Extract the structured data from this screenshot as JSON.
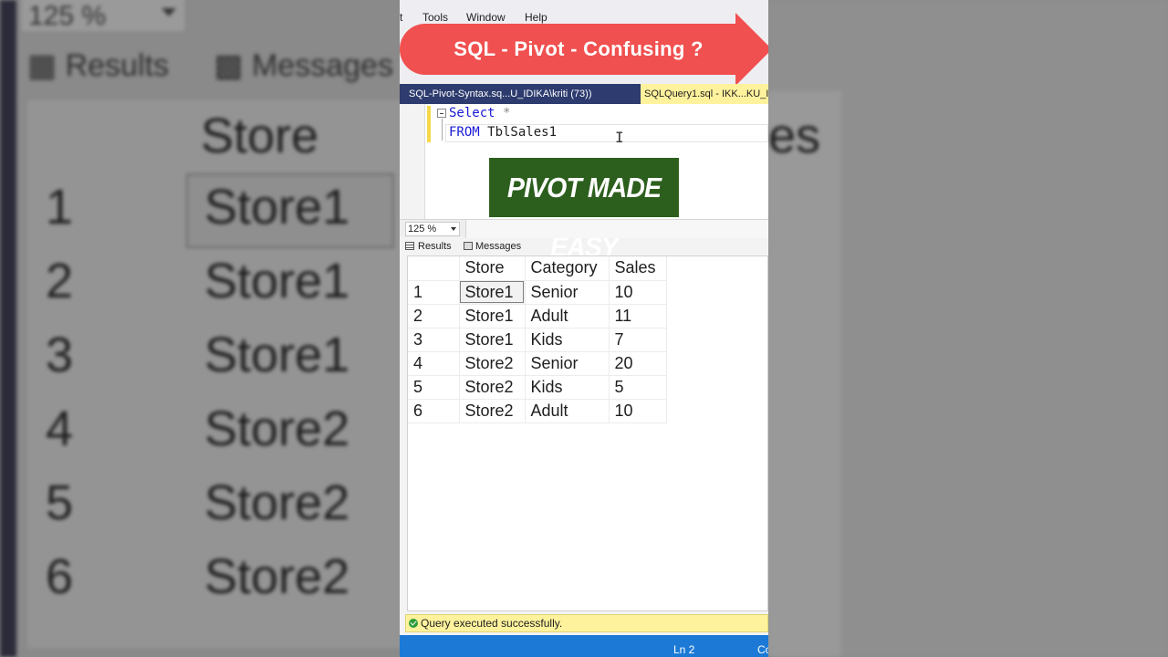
{
  "menu": {
    "items": [
      "t",
      "Tools",
      "Window",
      "Help"
    ]
  },
  "banner": {
    "text": "SQL - Pivot - Confusing ?",
    "color": "#f0504f"
  },
  "doc_tabs": {
    "inactive": "SQL-Pivot-Syntax.sq...U_IDIKA\\kriti (73))",
    "active": "SQLQuery1.sql - IKK...KU_I"
  },
  "editor": {
    "line1_keyword": "Select",
    "line1_rest": " *",
    "line2_keyword": "FROM",
    "line2_rest": " TblSales1"
  },
  "overlay_badge": {
    "text": "PIVOT MADE EASY",
    "color": "#2c5f1d"
  },
  "zoom": {
    "value": "125 %"
  },
  "result_tabs": {
    "results": "Results",
    "messages": "Messages"
  },
  "results_table": {
    "columns": [
      "Store",
      "Category",
      "Sales"
    ],
    "rows": [
      {
        "n": "1",
        "store": "Store1",
        "category": "Senior",
        "sales": "10"
      },
      {
        "n": "2",
        "store": "Store1",
        "category": "Adult",
        "sales": "11"
      },
      {
        "n": "3",
        "store": "Store1",
        "category": "Kids",
        "sales": "7"
      },
      {
        "n": "4",
        "store": "Store2",
        "category": "Senior",
        "sales": "20"
      },
      {
        "n": "5",
        "store": "Store2",
        "category": "Kids",
        "sales": "5"
      },
      {
        "n": "6",
        "store": "Store2",
        "category": "Adult",
        "sales": "10"
      }
    ]
  },
  "status": {
    "message": "Query executed successfully."
  },
  "statusbar": {
    "line": "Ln 2",
    "col": "Co"
  },
  "background": {
    "zoom": "125 %",
    "tab_results": "Results",
    "tab_messages": "Messages",
    "header_store": "Store",
    "header_sales_partial": "es",
    "rows": [
      {
        "n": "1",
        "store": "Store1"
      },
      {
        "n": "2",
        "store": "Store1"
      },
      {
        "n": "3",
        "store": "Store1"
      },
      {
        "n": "4",
        "store": "Store2"
      },
      {
        "n": "5",
        "store": "Store2"
      },
      {
        "n": "6",
        "store": "Store2"
      }
    ]
  }
}
